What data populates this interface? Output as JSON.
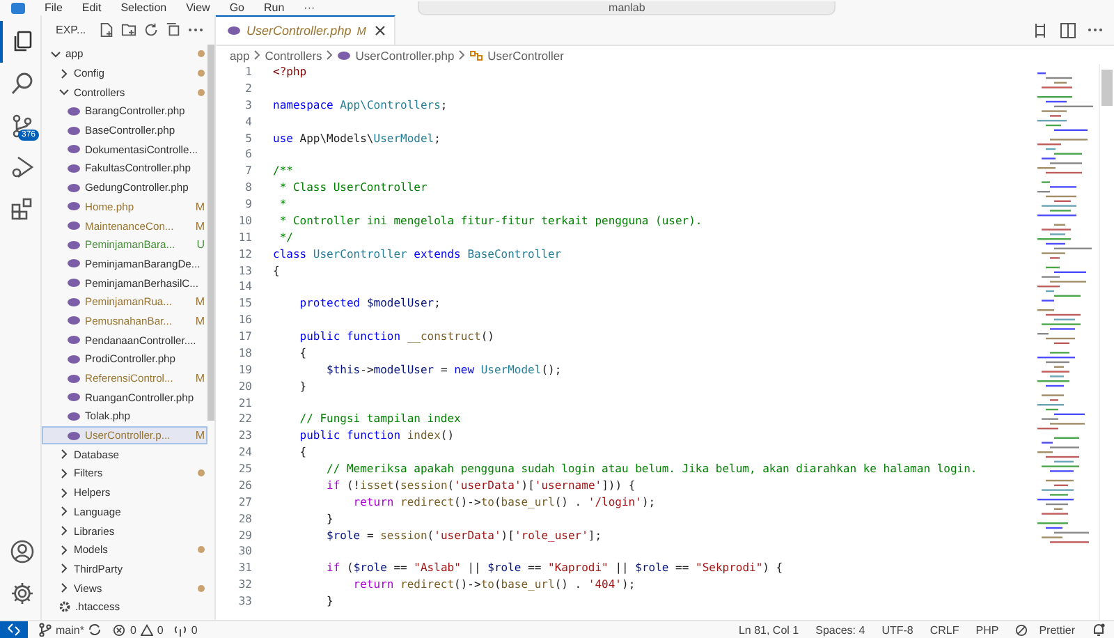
{
  "menu": [
    "File",
    "Edit",
    "Selection",
    "View",
    "Go",
    "Run",
    "···"
  ],
  "command_center": {
    "text": "manlab"
  },
  "activity_bar": {
    "items": [
      {
        "kind": "explorer",
        "selected": true
      },
      {
        "kind": "search",
        "selected": false
      },
      {
        "kind": "scm",
        "selected": false,
        "badge": "376"
      },
      {
        "kind": "debug",
        "selected": false
      },
      {
        "kind": "extensions",
        "selected": false
      }
    ],
    "bottom": [
      {
        "kind": "account"
      },
      {
        "kind": "settings"
      }
    ]
  },
  "explorer": {
    "title": "EXP...",
    "tree": [
      {
        "label": "app",
        "kind": "folder",
        "expanded": true,
        "modified": true,
        "children": [
          {
            "label": "Config",
            "kind": "folder",
            "expanded": false,
            "modified": true
          },
          {
            "label": "Controllers",
            "kind": "folder",
            "expanded": true,
            "modified": true,
            "children": [
              {
                "label": "BarangController.php",
                "kind": "php",
                "selected": false
              },
              {
                "label": "BaseController.php",
                "kind": "php",
                "selected": false
              },
              {
                "label": "DokumentasiControlle...",
                "kind": "php",
                "selected": false
              },
              {
                "label": "FakultasController.php",
                "kind": "php",
                "selected": false
              },
              {
                "label": "GedungController.php",
                "kind": "php",
                "selected": false
              },
              {
                "label": "Home.php",
                "kind": "php",
                "status": "M",
                "selected": false
              },
              {
                "label": "MaintenanceCon...",
                "kind": "php",
                "status": "M",
                "selected": false
              },
              {
                "label": "PeminjamanBara...",
                "kind": "php",
                "status": "U",
                "selected": false
              },
              {
                "label": "PeminjamanBarangDe...",
                "kind": "php",
                "selected": false
              },
              {
                "label": "PeminjamanBerhasilC...",
                "kind": "php",
                "selected": false
              },
              {
                "label": "PeminjamanRua...",
                "kind": "php",
                "status": "M",
                "selected": false
              },
              {
                "label": "PemusnahanBar...",
                "kind": "php",
                "status": "M",
                "selected": false
              },
              {
                "label": "PendanaanController....",
                "kind": "php",
                "selected": false
              },
              {
                "label": "ProdiController.php",
                "kind": "php",
                "selected": false
              },
              {
                "label": "ReferensiControl...",
                "kind": "php",
                "status": "M",
                "selected": false
              },
              {
                "label": "RuanganController.php",
                "kind": "php",
                "selected": false
              },
              {
                "label": "Tolak.php",
                "kind": "php",
                "selected": false
              },
              {
                "label": "UserController.p...",
                "kind": "php",
                "status": "M",
                "selected": true
              }
            ]
          },
          {
            "label": "Database",
            "kind": "folder",
            "expanded": false,
            "modified": false
          },
          {
            "label": "Filters",
            "kind": "folder",
            "expanded": false,
            "modified": true
          },
          {
            "label": "Helpers",
            "kind": "folder",
            "expanded": false,
            "modified": false
          },
          {
            "label": "Language",
            "kind": "folder",
            "expanded": false,
            "modified": false
          },
          {
            "label": "Libraries",
            "kind": "folder",
            "expanded": false,
            "modified": false
          },
          {
            "label": "Models",
            "kind": "folder",
            "expanded": false,
            "modified": true
          },
          {
            "label": "ThirdParty",
            "kind": "folder",
            "expanded": false,
            "modified": false
          },
          {
            "label": "Views",
            "kind": "folder",
            "expanded": false,
            "modified": true
          },
          {
            "label": ".htaccess",
            "kind": "config",
            "selected": false
          }
        ]
      }
    ]
  },
  "tab": {
    "label": "UserController.php",
    "status": "M",
    "selected": true
  },
  "breadcrumb": [
    {
      "label": "app",
      "kind": "folder"
    },
    {
      "label": "Controllers",
      "kind": "folder"
    },
    {
      "label": "UserController.php",
      "kind": "php"
    },
    {
      "label": "UserController",
      "kind": "class"
    }
  ],
  "code": [
    {
      "number": "1",
      "tokens": [
        {
          "kind": "tag",
          "text": "<?php"
        }
      ]
    },
    {
      "number": "2"
    },
    {
      "number": "3",
      "tokens": [
        {
          "kind": "kw",
          "text": "namespace "
        },
        {
          "kind": "cls",
          "text": "App\\Controllers"
        },
        {
          "kind": "plain",
          "text": ";"
        }
      ]
    },
    {
      "number": "4"
    },
    {
      "number": "5",
      "tokens": [
        {
          "kind": "kw",
          "text": "use"
        },
        {
          "kind": "plain",
          "text": " App\\Models\\"
        },
        {
          "kind": "cls",
          "text": "UserModel"
        },
        {
          "kind": "plain",
          "text": ";"
        }
      ]
    },
    {
      "number": "6"
    },
    {
      "number": "7",
      "tokens": [
        {
          "kind": "com",
          "text": "/**"
        }
      ]
    },
    {
      "number": "8",
      "tokens": [
        {
          "kind": "com",
          "text": " * Class UserController"
        }
      ]
    },
    {
      "number": "9",
      "tokens": [
        {
          "kind": "com",
          "text": " *"
        }
      ]
    },
    {
      "number": "10",
      "tokens": [
        {
          "kind": "com",
          "text": " * Controller ini mengelola fitur-fitur terkait pengguna (user)."
        }
      ]
    },
    {
      "number": "11",
      "tokens": [
        {
          "kind": "com",
          "text": " */"
        }
      ]
    },
    {
      "number": "12",
      "tokens": [
        {
          "kind": "kw",
          "text": "class "
        },
        {
          "kind": "cls",
          "text": "UserController "
        },
        {
          "kind": "kw",
          "text": "extends "
        },
        {
          "kind": "cls",
          "text": "BaseController"
        }
      ]
    },
    {
      "number": "13",
      "tokens": [
        {
          "kind": "plain",
          "text": "{"
        }
      ]
    },
    {
      "number": "14"
    },
    {
      "number": "15",
      "tokens": [
        {
          "kind": "kw",
          "text": "    protected "
        },
        {
          "kind": "var",
          "text": "$modelUser"
        },
        {
          "kind": "plain",
          "text": ";"
        }
      ]
    },
    {
      "number": "16"
    },
    {
      "number": "17",
      "tokens": [
        {
          "kind": "kw",
          "text": "    public function "
        },
        {
          "kind": "fn",
          "text": "__construct"
        },
        {
          "kind": "plain",
          "text": "()"
        }
      ]
    },
    {
      "number": "18",
      "tokens": [
        {
          "kind": "plain",
          "text": "    {"
        }
      ]
    },
    {
      "number": "19",
      "tokens": [
        {
          "kind": "var",
          "text": "        $this"
        },
        {
          "kind": "plain",
          "text": "->"
        },
        {
          "kind": "var",
          "text": "modelUser"
        },
        {
          "kind": "plain",
          "text": " = "
        },
        {
          "kind": "kw",
          "text": "new "
        },
        {
          "kind": "cls",
          "text": "UserModel"
        },
        {
          "kind": "plain",
          "text": "();"
        }
      ]
    },
    {
      "number": "20",
      "tokens": [
        {
          "kind": "plain",
          "text": "    }"
        }
      ]
    },
    {
      "number": "21"
    },
    {
      "number": "22",
      "tokens": [
        {
          "kind": "com",
          "text": "    // Fungsi tampilan index"
        }
      ]
    },
    {
      "number": "23",
      "tokens": [
        {
          "kind": "kw",
          "text": "    public function "
        },
        {
          "kind": "fn",
          "text": "index"
        },
        {
          "kind": "plain",
          "text": "()"
        }
      ]
    },
    {
      "number": "24",
      "tokens": [
        {
          "kind": "plain",
          "text": "    {"
        }
      ]
    },
    {
      "number": "25",
      "tokens": [
        {
          "kind": "com",
          "text": "        // Memeriksa apakah pengguna sudah login atau belum. Jika belum, akan diarahkan ke halaman login."
        }
      ]
    },
    {
      "number": "26",
      "tokens": [
        {
          "kind": "ctrl",
          "text": "        if"
        },
        {
          "kind": "plain",
          "text": " (!"
        },
        {
          "kind": "fn",
          "text": "isset"
        },
        {
          "kind": "plain",
          "text": "("
        },
        {
          "kind": "fn",
          "text": "session"
        },
        {
          "kind": "plain",
          "text": "("
        },
        {
          "kind": "str",
          "text": "'userData'"
        },
        {
          "kind": "plain",
          "text": ")["
        },
        {
          "kind": "str",
          "text": "'username'"
        },
        {
          "kind": "plain",
          "text": "])) {"
        }
      ]
    },
    {
      "number": "27",
      "tokens": [
        {
          "kind": "ctrl",
          "text": "            return "
        },
        {
          "kind": "fn",
          "text": "redirect"
        },
        {
          "kind": "plain",
          "text": "()->"
        },
        {
          "kind": "fn",
          "text": "to"
        },
        {
          "kind": "plain",
          "text": "("
        },
        {
          "kind": "fn",
          "text": "base_url"
        },
        {
          "kind": "plain",
          "text": "() . "
        },
        {
          "kind": "str",
          "text": "'/login'"
        },
        {
          "kind": "plain",
          "text": ");"
        }
      ]
    },
    {
      "number": "28",
      "tokens": [
        {
          "kind": "plain",
          "text": "        }"
        }
      ]
    },
    {
      "number": "29",
      "tokens": [
        {
          "kind": "var",
          "text": "        $role"
        },
        {
          "kind": "plain",
          "text": " = "
        },
        {
          "kind": "fn",
          "text": "session"
        },
        {
          "kind": "plain",
          "text": "("
        },
        {
          "kind": "str",
          "text": "'userData'"
        },
        {
          "kind": "plain",
          "text": ")["
        },
        {
          "kind": "str",
          "text": "'role_user'"
        },
        {
          "kind": "plain",
          "text": "];"
        }
      ]
    },
    {
      "number": "30"
    },
    {
      "number": "31",
      "tokens": [
        {
          "kind": "ctrl",
          "text": "        if"
        },
        {
          "kind": "plain",
          "text": " ("
        },
        {
          "kind": "var",
          "text": "$role"
        },
        {
          "kind": "plain",
          "text": " == "
        },
        {
          "kind": "str",
          "text": "\"Aslab\""
        },
        {
          "kind": "plain",
          "text": " || "
        },
        {
          "kind": "var",
          "text": "$role"
        },
        {
          "kind": "plain",
          "text": " == "
        },
        {
          "kind": "str",
          "text": "\"Kaprodi\""
        },
        {
          "kind": "plain",
          "text": " || "
        },
        {
          "kind": "var",
          "text": "$role"
        },
        {
          "kind": "plain",
          "text": " == "
        },
        {
          "kind": "str",
          "text": "\"Sekprodi\""
        },
        {
          "kind": "plain",
          "text": ") {"
        }
      ]
    },
    {
      "number": "32",
      "tokens": [
        {
          "kind": "ctrl",
          "text": "            return "
        },
        {
          "kind": "fn",
          "text": "redirect"
        },
        {
          "kind": "plain",
          "text": "()->"
        },
        {
          "kind": "fn",
          "text": "to"
        },
        {
          "kind": "plain",
          "text": "("
        },
        {
          "kind": "fn",
          "text": "base_url"
        },
        {
          "kind": "plain",
          "text": "() . "
        },
        {
          "kind": "str",
          "text": "'404'"
        },
        {
          "kind": "plain",
          "text": ");"
        }
      ]
    },
    {
      "number": "33",
      "tokens": [
        {
          "kind": "plain",
          "text": "        }"
        }
      ]
    }
  ],
  "status_bar": {
    "branch": "main*",
    "errors": "0",
    "warnings": "0",
    "ports": "0",
    "right": [
      "Ln 81, Col 1",
      "Spaces: 4",
      "UTF-8",
      "CRLF",
      "PHP",
      "Prettier"
    ]
  }
}
